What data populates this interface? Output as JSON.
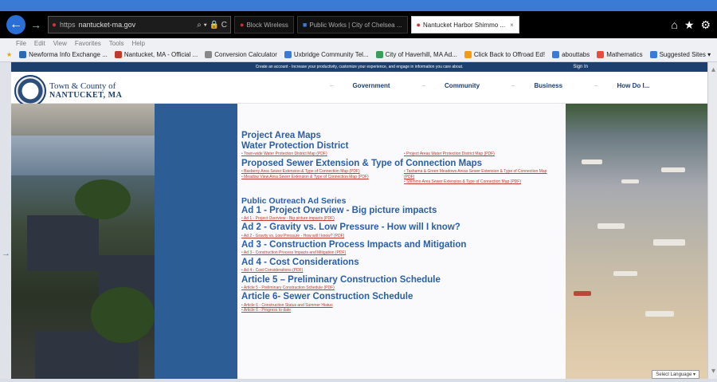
{
  "browser": {
    "url_scheme": "https",
    "url_display": "nantucket-ma.gov",
    "url_controls": "⌕ ▾ 🔒 C",
    "tabs": [
      {
        "label": "Block Wireless",
        "active": false
      },
      {
        "label": "Public Works | City of Chelsea ...",
        "active": false
      },
      {
        "label": "Nantucket Harbor Shimmo ...",
        "active": true
      }
    ],
    "tab_close": "×",
    "window_icons": [
      "⌂",
      "★",
      "⚙"
    ],
    "menu": [
      "File",
      "Edit",
      "View",
      "Favorites",
      "Tools",
      "Help"
    ],
    "favorites": [
      {
        "label": "Newforma Info Exchange ...",
        "color": "#2b6cb0"
      },
      {
        "label": "Nantucket, MA - Official ...",
        "color": "#c0392b"
      },
      {
        "label": "Conversion Calculator",
        "color": "#888"
      },
      {
        "label": "Uxbridge Community Tel...",
        "color": "#3a7bd5"
      },
      {
        "label": "City of Haverhill, MA Ad...",
        "color": "#3a9d5a"
      },
      {
        "label": "Click Back to Offroad Ed!",
        "color": "#f39c12"
      },
      {
        "label": "abouttabs",
        "color": "#3a7bd5"
      },
      {
        "label": "Mathematics",
        "color": "#e74c3c"
      },
      {
        "label": "Suggested Sites ▾",
        "color": "#3a7bd5"
      }
    ]
  },
  "site": {
    "topbar_text": "Create an account - Increase your productivity, customize your experience, and engage in information you care about.",
    "signin": "Sign In",
    "brand_line1": "Town & County of",
    "brand_line2": "NANTUCKET, MA",
    "nav": [
      "Government",
      "Community",
      "Business",
      "How Do I..."
    ],
    "nav_caret": "–",
    "language_button": "Select Language ▾"
  },
  "content": {
    "project_area_maps": "Project Area Maps",
    "water_protection": "Water Protection District",
    "wp_links_left": [
      "Town-wide Water Protection District Map (PDF)"
    ],
    "wp_links_right": [
      "Project Areas Water Protection District Map (PDF)"
    ],
    "sewer_ext": "Proposed Sewer Extension & Type of Connection Maps",
    "sewer_links_left": [
      "Baxberry Area Sewer Extension & Type of Connection Map (PDF)",
      "Meadow View Area Sewer Extension & Type of Connection Map (PDF)"
    ],
    "sewer_links_right": [
      "Tashama & Green Meadows Areas Sewer Extension & Type of Connection Map (PDF)",
      "Shimmo Area Sewer Extension & Type of Connection Map (PDF)"
    ],
    "outreach": "Public Outreach Ad Series",
    "ads": [
      {
        "title": "Ad 1 - Project Overview - Big picture impacts",
        "links": [
          "Ad 1 - Project Overview - Big picture impacts (PDF)"
        ]
      },
      {
        "title": "Ad 2 - Gravity vs. Low Pressure - How will I know?",
        "links": [
          "Ad 2 - Gravity vs. Low Pressure - How will I know? (PDF)"
        ]
      },
      {
        "title": "Ad 3 - Construction Process Impacts and Mitigation",
        "links": [
          "Ad 3 - Construction Process Impacts and Mitigation (PDF)"
        ]
      },
      {
        "title": "Ad 4 - Cost Considerations",
        "links": [
          "Ad 4 - Cost Considerations (PDF)"
        ]
      },
      {
        "title": "Article 5 – Preliminary Construction Schedule",
        "links": [
          "Article 5 - Preliminary Construction Schedule (PDF)"
        ]
      },
      {
        "title": "Article 6- Sewer Construction Schedule",
        "links": [
          "Article 6 - Construction Status and Summer Hiatus",
          "Article 6 - Progress to date"
        ]
      }
    ]
  },
  "scrollbar": {
    "up": "▴",
    "down": "▾"
  },
  "left_arrow": "→"
}
